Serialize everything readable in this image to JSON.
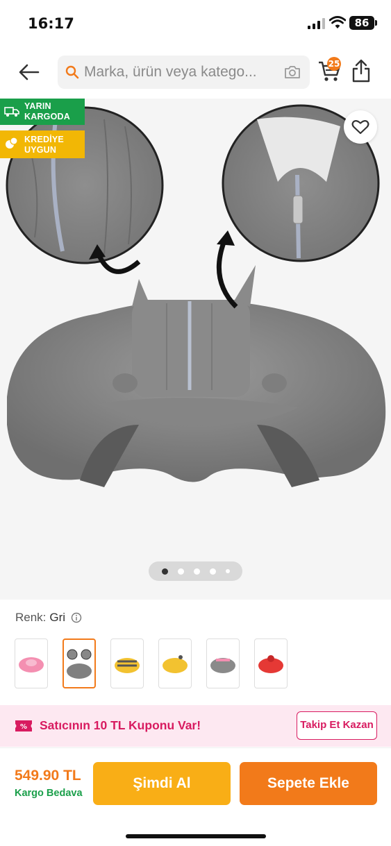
{
  "status_bar": {
    "time": "16:17",
    "battery": "86"
  },
  "search": {
    "placeholder": "Marka, ürün veya katego..."
  },
  "cart": {
    "count": "25"
  },
  "badges": {
    "fast_shipping": "YARIN KARGODA",
    "credit": "KREDİYE UYGUN"
  },
  "gallery": {
    "image_count": 5,
    "active_index": 0
  },
  "color": {
    "label": "Renk:",
    "value": "Gri"
  },
  "swatches": [
    {
      "name": "pink",
      "color": "#f48fb1"
    },
    {
      "name": "gray",
      "color": "#808080"
    },
    {
      "name": "yellow-gray-bee",
      "color": "#f2c230"
    },
    {
      "name": "yellow",
      "color": "#f2c230"
    },
    {
      "name": "gray-pink",
      "color": "#8a8a8a"
    },
    {
      "name": "red",
      "color": "#e53935"
    }
  ],
  "coupon": {
    "text": "Satıcının 10 TL Kuponu Var!",
    "button": "Takip Et Kazan"
  },
  "bottom": {
    "price": "549.90 TL",
    "shipping": "Kargo Bedava",
    "buy_now": "Şimdi Al",
    "add_to_cart": "Sepete Ekle"
  },
  "colors": {
    "accent": "#f27a1a",
    "green": "#1a9f4a",
    "pink": "#d81b60",
    "yellow": "#f9ae16"
  }
}
